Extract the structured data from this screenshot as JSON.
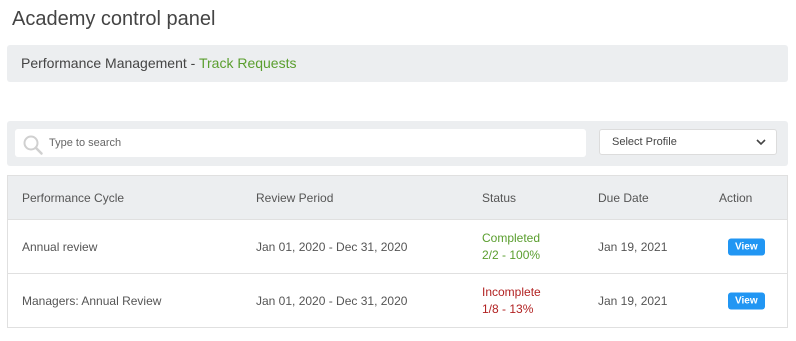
{
  "page": {
    "title": "Academy control panel"
  },
  "breadcrumb": {
    "section": "Performance Management",
    "separator": " - ",
    "current": "Track Requests",
    "link_color": "#5a9e2e"
  },
  "filters": {
    "search_placeholder": "Type to search",
    "search_icon": "search-icon",
    "profile_select": {
      "selected": "Select Profile",
      "icon": "chevron-down-icon"
    }
  },
  "table": {
    "headers": {
      "cycle": "Performance Cycle",
      "period": "Review Period",
      "status": "Status",
      "due": "Due Date",
      "action": "Action"
    },
    "rows": [
      {
        "cycle": "Annual review",
        "period": "Jan 01, 2020 - Dec 31, 2020",
        "status": "Completed",
        "progress": "2/2 - 100%",
        "status_color": "#5a9e2e",
        "due": "Jan 19, 2021",
        "action": "View"
      },
      {
        "cycle": "Managers: Annual Review",
        "period": "Jan 01, 2020 - Dec 31, 2020",
        "status": "Incomplete",
        "progress": "1/8 - 13%",
        "status_color": "#b22222",
        "due": "Jan 19, 2021",
        "action": "View"
      }
    ]
  },
  "colors": {
    "button": "#2196f3",
    "panel_bg": "#eceef0"
  }
}
